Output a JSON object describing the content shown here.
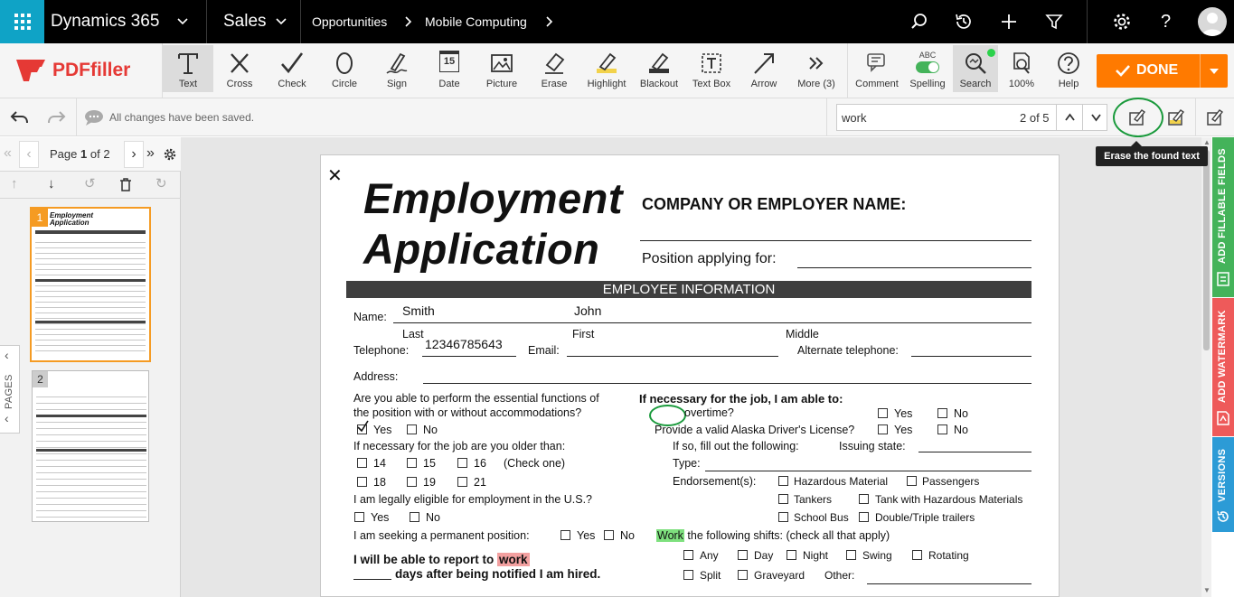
{
  "topbar": {
    "app_title": "Dynamics 365",
    "module": "Sales",
    "breadcrumb": [
      "Opportunities",
      "Mobile Computing"
    ]
  },
  "toolbar": {
    "logo_text": "PDFfiller",
    "tools": [
      "Text",
      "Cross",
      "Check",
      "Circle",
      "Sign",
      "Date",
      "Picture",
      "Erase",
      "Highlight",
      "Blackout",
      "Text Box",
      "Arrow",
      "More (3)"
    ],
    "date_icon_num": "15",
    "right_tools": [
      "Comment",
      "Spelling",
      "Search",
      "100%",
      "Help"
    ],
    "spelling_badge": "ABC",
    "done_label": "DONE"
  },
  "subbar": {
    "status": "All changes have been saved.",
    "search_value": "work",
    "search_count": "2 of 5",
    "tooltip": "Erase the found text"
  },
  "pages": {
    "label": "Page",
    "current": "1",
    "of": "of",
    "total": "2",
    "side_label": "PAGES",
    "thumb1": "1",
    "thumb2": "2"
  },
  "right_strips": [
    "ADD FILLABLE FIELDS",
    "ADD WATERMARK",
    "VERSIONS"
  ],
  "doc": {
    "title1": "Employment",
    "title2": "Application",
    "company": "COMPANY OR EMPLOYER NAME:",
    "position": "Position applying for:",
    "section": "EMPLOYEE INFORMATION",
    "name_label": "Name:",
    "last_value": "Smith",
    "first_value": "John",
    "last": "Last",
    "first": "First",
    "middle": "Middle",
    "telephone": "Telephone:",
    "tel_value": "12346785643",
    "email": "Email:",
    "alt_tel": "Alternate telephone:",
    "address": "Address:",
    "q1a": "Are you able to perform the essential functions of",
    "q1b": "the position with or without accommodations?",
    "yes": "Yes",
    "no": "No",
    "q2": "If necessary for the job are you older than:",
    "ages": [
      "14",
      "15",
      "16",
      "18",
      "19",
      "21"
    ],
    "check_one": "(Check one)",
    "q3": "I am legally eligible for employment in the U.S.?",
    "q4": "I am seeking a permanent position:",
    "q5a": "I will be able to report to ",
    "q5_hl": "work",
    "q5b": "days after being notified I am hired.",
    "r1": "If necessary for the job, I am able to:",
    "r_overtime": "overtime?",
    "r_driver": "Provide a valid Alaska Driver's License?",
    "r_fill": "If so, fill out the following:",
    "r_issuing": "Issuing state:",
    "r_type": "Type:",
    "r_endorse": "Endorsement(s):",
    "endorsements": [
      "Hazardous Material",
      "Passengers",
      "Tankers",
      "Tank with Hazardous Materials",
      "School Bus",
      "Double/Triple trailers"
    ],
    "work_hl": "Work",
    "shifts": "the following shifts: (check all that apply)",
    "shift_opts": [
      "Any",
      "Day",
      "Night",
      "Swing",
      "Rotating",
      "Split",
      "Graveyard",
      "Other:"
    ]
  },
  "colors": {
    "top": "#000000",
    "apps": "#0fa3c6",
    "done": "#ff7a00",
    "pdfred": "#e53935",
    "green": "#44b35a",
    "red": "#ee5a5a",
    "blue": "#2c9bd6"
  }
}
